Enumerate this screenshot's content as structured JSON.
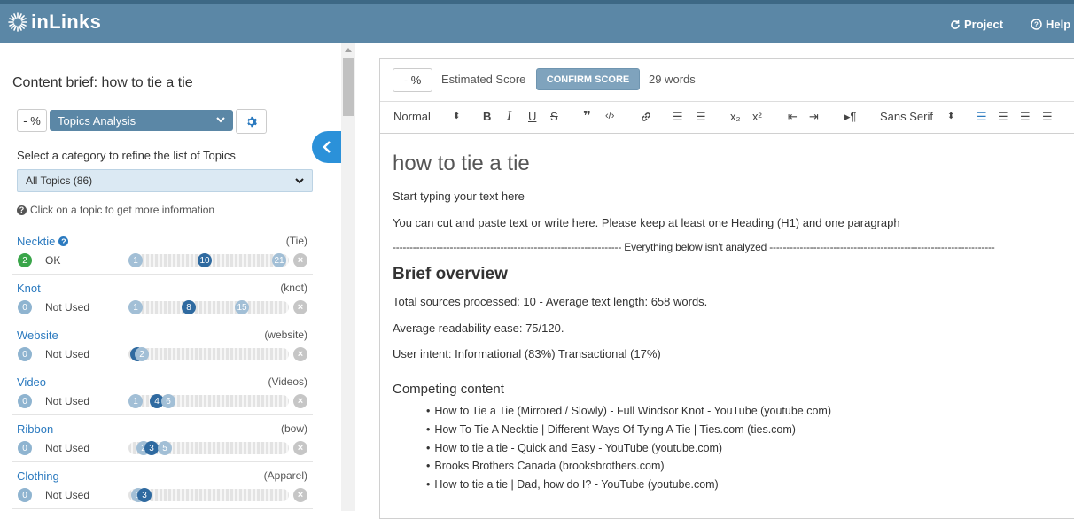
{
  "header": {
    "logo_text": "inLinks",
    "project_label": "Project",
    "help_label": "Help",
    "brand_color": "#5b87a6"
  },
  "left_panel": {
    "title": "Content brief: how to tie a tie",
    "score_pct": "- %",
    "analysis_select": "Topics Analysis",
    "refine_label": "Select a category to refine the list of Topics",
    "category_select": "All Topics (86)",
    "hint": "Click on a topic to get more information",
    "topics": [
      {
        "name": "Necktie",
        "has_info": true,
        "alias": "(Tie)",
        "count": "2",
        "status": "OK",
        "markers": [
          "1",
          "10",
          "21"
        ]
      },
      {
        "name": "Knot",
        "has_info": false,
        "alias": "(knot)",
        "count": "0",
        "status": "Not Used",
        "markers": [
          "1",
          "8",
          "15"
        ]
      },
      {
        "name": "Website",
        "has_info": false,
        "alias": "(website)",
        "count": "0",
        "status": "Not Used",
        "markers": [
          "",
          "2"
        ]
      },
      {
        "name": "Video",
        "has_info": false,
        "alias": "(Videos)",
        "count": "0",
        "status": "Not Used",
        "markers": [
          "1",
          "4",
          "6"
        ]
      },
      {
        "name": "Ribbon",
        "has_info": false,
        "alias": "(bow)",
        "count": "0",
        "status": "Not Used",
        "markers": [
          "2",
          "3",
          "5"
        ]
      },
      {
        "name": "Clothing",
        "has_info": false,
        "alias": "(Apparel)",
        "count": "0",
        "status": "Not Used",
        "markers": [
          "1",
          "3"
        ]
      }
    ]
  },
  "editor": {
    "score_pct": "- %",
    "estimated_score_label": "Estimated Score",
    "confirm_label": "CONFIRM SCORE",
    "word_count": "29 words",
    "toolbar": {
      "heading_select": "Normal",
      "font_select": "Sans Serif"
    },
    "document": {
      "title": "how to tie a tie",
      "line1": "Start typing your text here",
      "line2": "You can cut and paste text or write here. Please keep at least one Heading (H1) and one paragraph",
      "separator": "-------------------------------------------------------------------- Everything below isn't analyzed -------------------------------------------------------------------",
      "overview_heading": "Brief overview",
      "stat1": "Total sources processed: 10 - Average text length: 658 words.",
      "stat2": "Average readability ease: 75/120.",
      "stat3": "User intent: Informational (83%) Transactional (17%)",
      "competing_heading": "Competing content",
      "competing": [
        "How to Tie a Tie (Mirrored / Slowly) - Full Windsor Knot - YouTube (youtube.com)",
        "How To Tie A Necktie | Different Ways Of Tying A Tie | Ties.com (ties.com)",
        "How to tie a tie - Quick and Easy - YouTube (youtube.com)",
        "Brooks Brothers Canada (brooksbrothers.com)",
        "How to tie a tie | Dad, how do I? - YouTube (youtube.com)"
      ]
    }
  }
}
